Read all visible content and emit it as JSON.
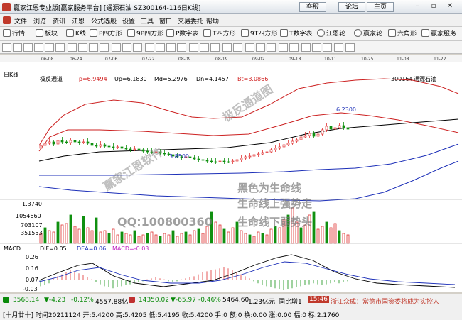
{
  "window": {
    "title": "赢家江恩专业版[赢家服务平台]  [通源石油  SZ300164-116日K线]",
    "btn_kefu": "客服",
    "btn_luntan": "论坛",
    "btn_zhuye": "主页",
    "min_icon": "minimize-icon",
    "max_icon": "maximize-icon",
    "close_icon": "close-icon"
  },
  "menu": [
    "文件",
    "浏览",
    "资讯",
    "江恩",
    "公式选股",
    "设置",
    "工具",
    "窗口",
    "交易委托",
    "帮助"
  ],
  "toolbar": [
    "行情",
    "板块",
    "K线",
    "P四方形",
    "9P四方形",
    "P数字表",
    "T四方形",
    "9T四方形",
    "T数字表",
    "江恩轮",
    "赢家轮",
    "六角形",
    "赢家服务"
  ],
  "chart": {
    "period_label": "日K线",
    "indicator": "极反通道",
    "tp": "Tp=6.9494",
    "up": "Up=6.1830",
    "md": "Md=5.2976",
    "dn": "Dn=4.1457",
    "bt": "Bt=3.0866",
    "stock_code": "300164",
    "stock_name": "通源石油",
    "date_ticks": [
      "06-08",
      "06-24",
      "07-06",
      "07-22",
      "08-09",
      "08-19",
      "09-02",
      "09-18",
      "10-11",
      "10-25",
      "11-08",
      "11-22"
    ],
    "price_label_high": "6.2300",
    "price_label_low": "3.8500",
    "vol_ticks": [
      "1.3740",
      "1054660",
      "703107",
      "351553"
    ],
    "macd_label": "MACD",
    "dif": "DIF=0.05",
    "dea": "DEA=0.06",
    "macd": "MACD=-0.03",
    "macd_ticks": [
      "0.26",
      "0.16",
      "0.07",
      "-0.03"
    ],
    "watermarks": [
      "赢家江恩软件",
      "极反通道图",
      "黑色为生命线",
      "生命线上强势走",
      "QQ:100800360",
      "生命线下弱势头"
    ]
  },
  "status1": {
    "index1": "3568.14",
    "chg1": "▼-4.23",
    "pct1": "-0.12%",
    "amt1": "4557.88亿",
    "index2": "14350.02",
    "chg2": "▼-65.97",
    "pct2": "-0.46%",
    "amt2": "5464.60",
    "amt3": "1.23亿元",
    "note": "同比增1",
    "time": "15:46",
    "news": "浙江众成：常德市国资委将成为实控人"
  },
  "status2": {
    "text": "[十月廿十] 时间20211124 开:5.4200 高:5.4205 低:5.4195 收:5.4200 手:0 额:0 换:0.00 涨:0.00 幅:0 标:2.1760"
  },
  "colors": {
    "up": "#e03030",
    "down": "#109010",
    "upper_band": "#cc2020",
    "lower_band": "#1c2fb8",
    "life_line": "#000000"
  }
}
